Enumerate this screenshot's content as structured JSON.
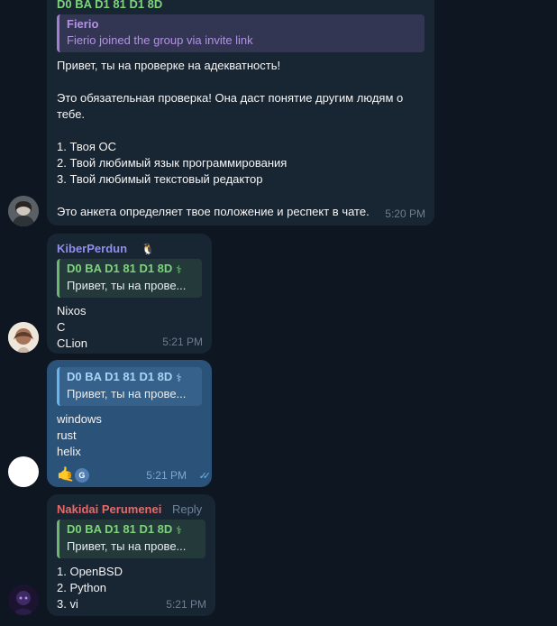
{
  "messages": {
    "m1": {
      "quote_author_partial": "D0 BA D1 81 D1 8D",
      "quote": {
        "author": "Fierio",
        "text": "Fierio joined the group via invite link"
      },
      "lines": [
        "Привет, ты на проверке на адекватность!",
        "",
        "Это обязательная проверка! Она даст понятие другим людям о",
        "тебе.",
        "",
        "1. Твоя ОС",
        "2. Твой любимый язык программирования",
        "3. Твой любимый текстовый редактор",
        "",
        "Это анкета определяет твое положение и респект в чате."
      ],
      "time": "5:20 PM"
    },
    "m2": {
      "sender": "KiberPerdun",
      "sender_color": "#8f8ef0",
      "quote": {
        "author": "D0 BA D1 81 D1 8D",
        "text": "Привет, ты на прове..."
      },
      "lines": [
        "Nixos",
        "C",
        "CLion"
      ],
      "time": "5:21 PM"
    },
    "m3": {
      "quote": {
        "author": "D0 BA D1 81 D1 8D",
        "text": "Привет, ты на прове..."
      },
      "lines": [
        "windows",
        "rust",
        "helix"
      ],
      "reaction_emoji": "🤙",
      "reaction_user_initial": "G",
      "time": "5:21 PM"
    },
    "m4": {
      "sender": "Nakidai Perumenei",
      "sender_color": "#e76a6a",
      "reply_label": "Reply",
      "quote": {
        "author": "D0 BA D1 81 D1 8D",
        "text": "Привет, ты на прове..."
      },
      "lines": [
        "1. OpenBSD",
        "2. Python",
        "3. vi"
      ],
      "time": "5:21 PM"
    }
  }
}
